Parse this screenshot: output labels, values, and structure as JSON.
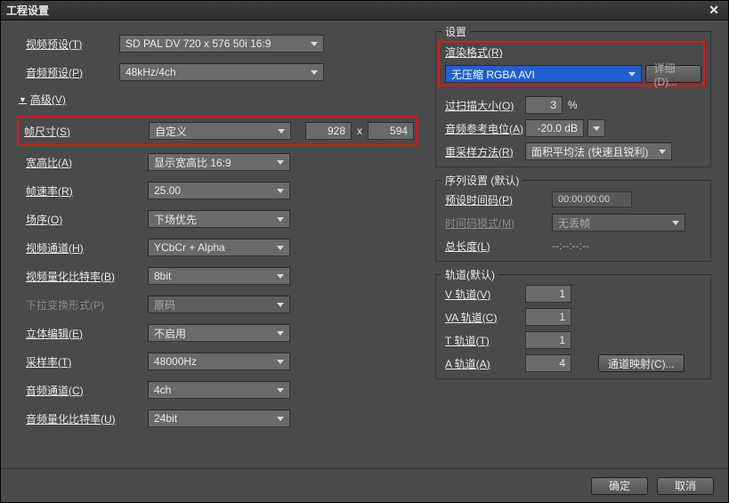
{
  "title": "工程设置",
  "left": {
    "video_preset_label": "视频预设(T)",
    "video_preset_value": "SD PAL DV 720 x 576 50i 16:9",
    "audio_preset_label": "音频预设(P)",
    "audio_preset_value": "48kHz/4ch",
    "advanced_label": "高级(V)",
    "frame_size_label": "帧尺寸(S)",
    "frame_size_mode": "自定义",
    "frame_w": "928",
    "frame_h": "594",
    "aspect_label": "宽高比(A)",
    "aspect_value": "显示宽高比 16:9",
    "fps_label": "帧速率(R)",
    "fps_value": "25.00",
    "field_label": "场序(O)",
    "field_value": "下场优先",
    "video_ch_label": "视频通道(H)",
    "video_ch_value": "YCbCr + Alpha",
    "video_bit_label": "视频量化比特率(B)",
    "video_bit_value": "8bit",
    "pulldown_label": "下拉变换形式(P)",
    "pulldown_value": "原码",
    "stereo_label": "立体编辑(E)",
    "stereo_value": "不启用",
    "sample_label": "采样率(T)",
    "sample_value": "48000Hz",
    "audio_ch_label": "音频通道(C)",
    "audio_ch_value": "4ch",
    "audio_bit_label": "音频量化比特率(U)",
    "audio_bit_value": "24bit"
  },
  "right": {
    "settings_legend": "设置",
    "render_label": "渲染格式(R)",
    "render_value": "无压缩 RGBA AVI",
    "detail_btn": "详细(D)...",
    "overscan_label": "过扫描大小(O)",
    "overscan_value": "3",
    "overscan_unit": "%",
    "audio_ref_label": "音频参考电位(A)",
    "audio_ref_value": "-20.0 dB",
    "resample_label": "重采样方法(R)",
    "resample_value": "面积平均法 (快速且锐利)",
    "seq_legend": "序列设置 (默认)",
    "preset_tc_label": "预设时间码(P)",
    "preset_tc_value": "00:00:00:00",
    "tc_mode_label": "时间码模式(M)",
    "tc_mode_value": "无丢帧",
    "total_len_label": "总长度(L)",
    "total_len_value": "--:--:--:--",
    "track_legend": "轨道(默认)",
    "v_track_label": "V 轨道(V)",
    "v_track_value": "1",
    "va_track_label": "VA 轨道(C)",
    "va_track_value": "1",
    "t_track_label": "T 轨道(T)",
    "t_track_value": "1",
    "a_track_label": "A 轨道(A)",
    "a_track_value": "4",
    "channel_map_btn": "通道映射(C)..."
  },
  "footer": {
    "ok": "确定",
    "cancel": "取消"
  }
}
